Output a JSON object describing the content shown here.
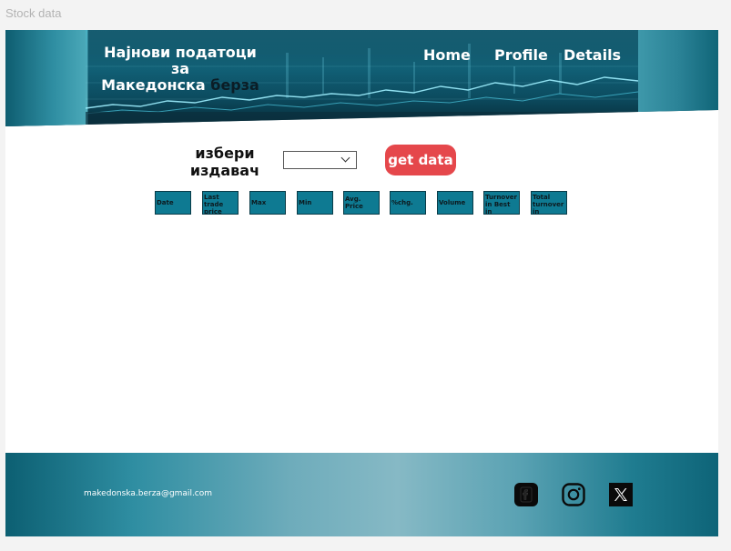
{
  "frame": {
    "label": "Stock data"
  },
  "header": {
    "title_line1": "Најнови податоци за",
    "title_line2_light": "Македонска ",
    "title_line2_dark": "берза",
    "nav": [
      {
        "label": "Home"
      },
      {
        "label": "Profile"
      },
      {
        "label": "Details"
      }
    ]
  },
  "controls": {
    "picker_label_line1": "избери",
    "picker_label_line2": "издавач",
    "select_value": "",
    "button_label": "get data",
    "button_color": "#e5474b"
  },
  "table": {
    "columns": [
      "Date",
      "Last trade price",
      "Max",
      "Min",
      "Avg. Price",
      "%chg.",
      "Volume",
      "Turnover in Best in denars",
      "Total turnover in denars"
    ]
  },
  "footer": {
    "email": "makedonska.berza@gmail.com",
    "social": [
      "facebook-icon",
      "instagram-icon",
      "x-icon"
    ]
  },
  "colors": {
    "accent": "#0e7a92",
    "footer_mid": "#86b9c5"
  }
}
